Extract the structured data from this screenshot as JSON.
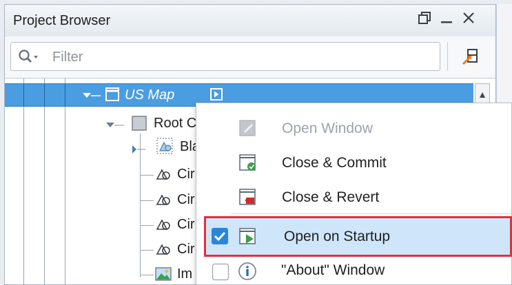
{
  "header": {
    "title": "Project Browser"
  },
  "filter": {
    "placeholder": "Filter"
  },
  "tree": {
    "selected": {
      "label": "US Map"
    },
    "items": [
      {
        "label": "Root C"
      },
      {
        "label": "Bla"
      },
      {
        "label": "Cir"
      },
      {
        "label": "Cir"
      },
      {
        "label": "Cir"
      },
      {
        "label": "Cir"
      },
      {
        "label": "Im"
      }
    ]
  },
  "context_menu": {
    "items": [
      {
        "label": "Open Window",
        "enabled": false
      },
      {
        "label": "Close & Commit",
        "enabled": true
      },
      {
        "label": "Close & Revert",
        "enabled": true
      },
      {
        "label": "Open on Startup",
        "enabled": true,
        "checked": true
      },
      {
        "label": "\"About\" Window",
        "enabled": true,
        "checked": false
      }
    ]
  },
  "colors": {
    "selection": "#4a9de0",
    "highlight_border": "#e0303a",
    "checkbox": "#2b86d9",
    "menu_hover": "#cfe6fa"
  }
}
